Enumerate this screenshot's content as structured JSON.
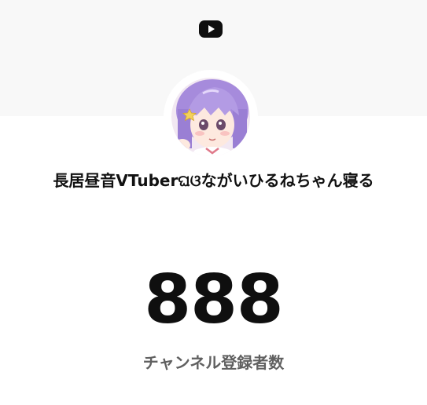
{
  "header": {
    "logo_icon": "youtube-play-icon",
    "banner_color": "#f8f8f8"
  },
  "channel": {
    "avatar_icon": "channel-avatar-anime-character",
    "name": "長居昼音VTuberଘଓながいひるねちゃん寝る"
  },
  "stats": {
    "subscriber_count": "888",
    "subscriber_label": "チャンネル登録者数"
  },
  "colors": {
    "count_text": "#0f0f0f",
    "label_text": "#606060",
    "avatar_hair": "#a68bdc"
  }
}
